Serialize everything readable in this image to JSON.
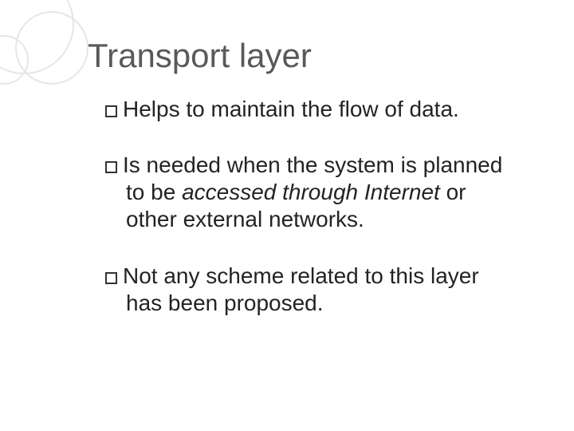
{
  "slide": {
    "title": "Transport layer",
    "bullets": [
      {
        "text": "Helps to maintain the flow of data."
      },
      {
        "prefix": "Is needed when the system is planned to be ",
        "italic": "accessed through Internet",
        "suffix": " or other external networks."
      },
      {
        "text": "Not any scheme related to this layer has been proposed."
      }
    ]
  }
}
